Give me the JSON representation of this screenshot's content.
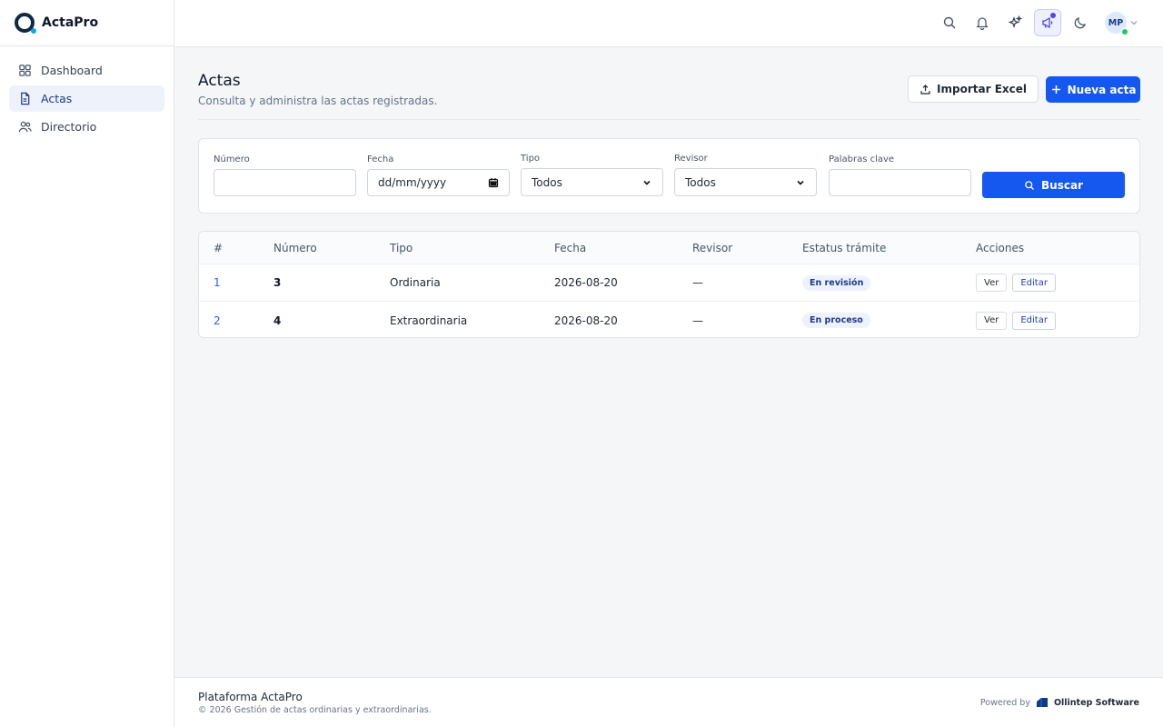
{
  "brand": {
    "name": "ActaPro"
  },
  "sidebar": {
    "items": [
      {
        "label": "Dashboard",
        "icon": "grid-icon",
        "active": false
      },
      {
        "label": "Actas",
        "icon": "document-icon",
        "active": true
      },
      {
        "label": "Directorio",
        "icon": "users-icon",
        "active": false
      }
    ]
  },
  "header": {
    "icons": [
      "search-icon",
      "bell-icon",
      "sparkles-icon",
      "megaphone-icon",
      "moon-icon"
    ],
    "avatar_initials": "MP"
  },
  "page": {
    "title": "Actas",
    "subtitle": "Consulta y administra las actas registradas.",
    "import_label": "Importar Excel",
    "new_label": "Nueva acta"
  },
  "filters": {
    "numero_label": "Número",
    "numero_value": "",
    "fecha_label": "Fecha",
    "fecha_placeholder": "dd/mm/yyyy",
    "tipo_label": "Tipo",
    "tipo_value": "Todos",
    "revisor_label": "Revisor",
    "revisor_value": "Todos",
    "keywords_label": "Palabras clave",
    "keywords_value": "",
    "search_label": "Buscar"
  },
  "table": {
    "columns": [
      "#",
      "Número",
      "Tipo",
      "Fecha",
      "Revisor",
      "Estatus trámite",
      "Acciones"
    ],
    "rows": [
      {
        "idx": "1",
        "numero": "3",
        "tipo": "Ordinaria",
        "fecha": "2026-08-20",
        "revisor": "—",
        "estatus": "En revisión",
        "ver": "Ver",
        "editar": "Editar"
      },
      {
        "idx": "2",
        "numero": "4",
        "tipo": "Extraordinaria",
        "fecha": "2026-08-20",
        "revisor": "—",
        "estatus": "En proceso",
        "ver": "Ver",
        "editar": "Editar"
      }
    ]
  },
  "footer": {
    "title": "Plataforma ActaPro",
    "subtitle": "© 2026 Gestión de actas ordinarias y extraordinarias.",
    "powered_by": "Powered by",
    "company": "Ollintep Software"
  },
  "colors": {
    "primary": "#1458f0",
    "sidebar_active_bg": "#eef2fb",
    "online": "#22c55e"
  }
}
